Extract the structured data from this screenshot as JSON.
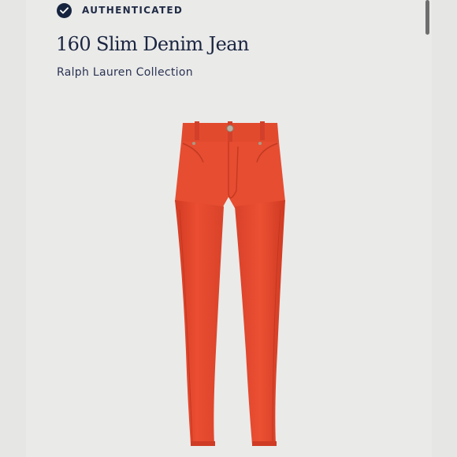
{
  "badge": {
    "label": "AUTHENTICATED",
    "icon": "check-circle-icon"
  },
  "product": {
    "title": "160 Slim Denim Jean",
    "brand": "Ralph Lauren Collection",
    "image_alt": "orange slim jeans",
    "color": "#e8492e"
  },
  "colors": {
    "navy": "#1a2540",
    "background": "#eaeae9"
  }
}
